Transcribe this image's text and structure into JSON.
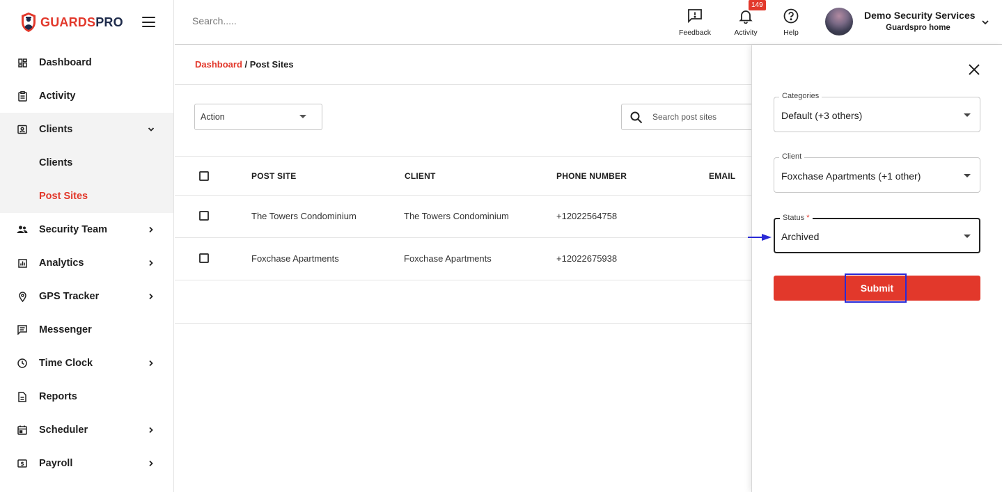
{
  "brand": {
    "logo_part1": "GUARDS",
    "logo_part2": "PRO",
    "accent": "#e2382b",
    "navy": "#1d2a4a"
  },
  "sidebar": {
    "items": [
      {
        "label": "Dashboard",
        "icon": "dashboard-icon"
      },
      {
        "label": "Activity",
        "icon": "clipboard-icon"
      },
      {
        "label": "Clients",
        "icon": "contact-card-icon",
        "expanded": true,
        "children": [
          {
            "label": "Clients"
          },
          {
            "label": "Post Sites",
            "active": true
          }
        ]
      },
      {
        "label": "Security Team",
        "icon": "people-icon"
      },
      {
        "label": "Analytics",
        "icon": "bar-chart-icon"
      },
      {
        "label": "GPS Tracker",
        "icon": "location-pin-icon"
      },
      {
        "label": "Messenger",
        "icon": "message-icon"
      },
      {
        "label": "Time Clock",
        "icon": "clock-icon"
      },
      {
        "label": "Reports",
        "icon": "document-icon"
      },
      {
        "label": "Scheduler",
        "icon": "calendar-icon"
      },
      {
        "label": "Payroll",
        "icon": "money-icon"
      }
    ]
  },
  "topbar": {
    "search_placeholder": "Search.....",
    "feedback_label": "Feedback",
    "activity_label": "Activity",
    "activity_badge": "149",
    "help_label": "Help",
    "org_name": "Demo Security Services",
    "org_sub": "Guardspro home"
  },
  "breadcrumb": {
    "root": "Dashboard",
    "separator": " / ",
    "current": "Post Sites"
  },
  "toolbar": {
    "action_label": "Action",
    "search_placeholder": "Search post sites"
  },
  "table": {
    "headers": [
      "POST SITE",
      "CLIENT",
      "PHONE NUMBER",
      "EMAIL"
    ],
    "rows": [
      {
        "post_site": "The Towers Condominium",
        "client": "The Towers Condominium",
        "phone": "+12022564758",
        "email": ""
      },
      {
        "post_site": "Foxchase Apartments",
        "client": "Foxchase Apartments",
        "phone": "+12022675938",
        "email": ""
      }
    ]
  },
  "drawer": {
    "categories_label": "Categories",
    "categories_value": "Default (+3 others)",
    "client_label": "Client",
    "client_value": "Foxchase Apartments (+1 other)",
    "status_label": "Status",
    "status_required": "*",
    "status_value": "Archived",
    "submit_label": "Submit"
  }
}
